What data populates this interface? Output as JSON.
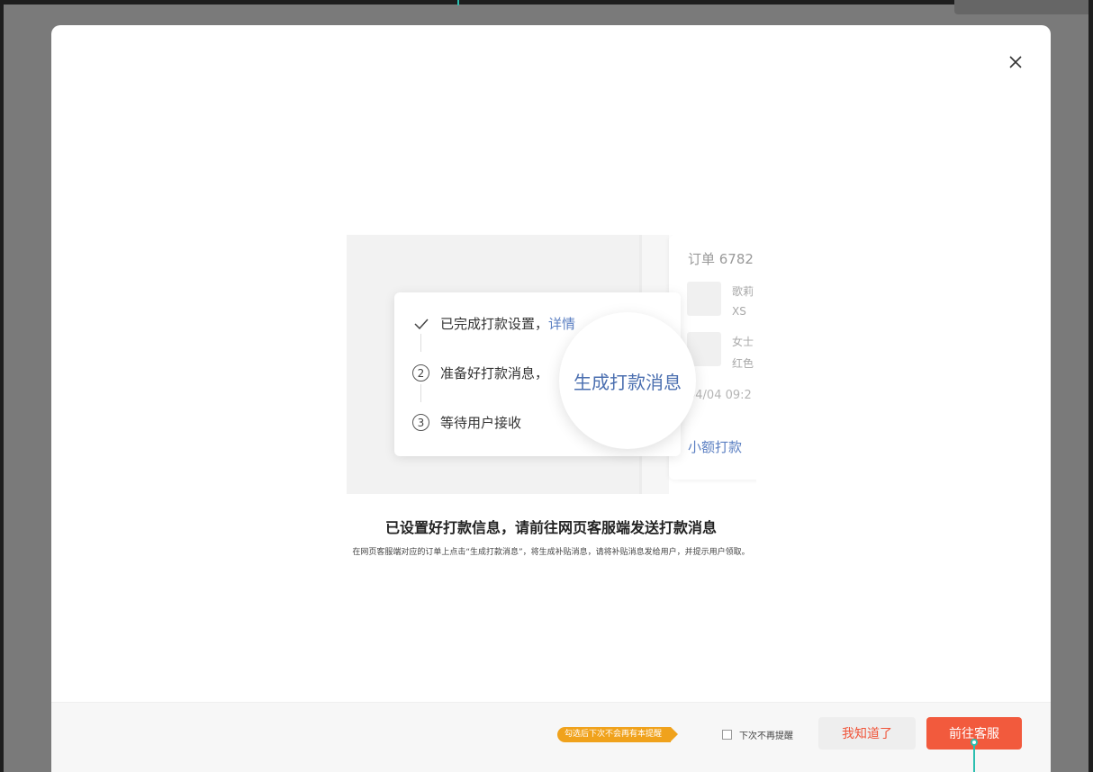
{
  "modal": {
    "close_icon": "close-icon",
    "illustration": {
      "steps": [
        {
          "marker": "✓",
          "text": "已完成打款设置，",
          "link": "详情"
        },
        {
          "marker": "2",
          "text": "准备好打款消息，"
        },
        {
          "marker": "3",
          "text": "等待用户接收"
        }
      ],
      "magnifier_text": "生成打款消息",
      "order": {
        "title": "订单 6782",
        "item1": {
          "line1": "歌莉",
          "line2": "XS"
        },
        "item2": {
          "line1": "女士",
          "line2": "红色"
        },
        "time": "04/04 09:2",
        "link": "小额打款"
      }
    },
    "title": "已设置好打款信息，请前往网页客服端发送打款消息",
    "description": "在网页客服端对应的订单上点击“生成打款消息”，将生成补贴消息，请将补贴消息发给用户，并提示用户领取。"
  },
  "footer": {
    "tip_badge": "勾选后下次不会再有本提醒",
    "checkbox_label": "下次不再提醒",
    "checkbox_checked": false,
    "know_button": "我知道了",
    "service_button": "前往客服"
  },
  "colors": {
    "accent": "#f25a3d",
    "link": "#5b7fc2",
    "badge": "#f0a21c",
    "cursor": "#2bbfb0"
  }
}
